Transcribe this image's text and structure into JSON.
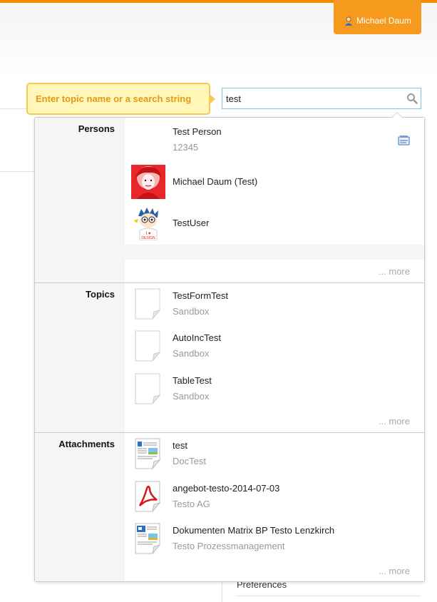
{
  "header": {
    "user_name": "Michael Daum",
    "accent_color": "#f28c00",
    "user_icon": "user-icon"
  },
  "background": {
    "stray_text": "{",
    "preferences_link": "Preferences"
  },
  "search": {
    "tooltip": "Enter topic name or a search string",
    "value": "test",
    "icon": "search-icon"
  },
  "results": {
    "more_label": "... more",
    "persons": {
      "label": "Persons",
      "items": [
        {
          "name": "Test Person",
          "detail": "12345",
          "icon": "vcard-icon"
        },
        {
          "name": "Michael Daum (Test)",
          "detail": ""
        },
        {
          "name": "TestUser",
          "detail": ""
        }
      ]
    },
    "topics": {
      "label": "Topics",
      "items": [
        {
          "name": "TestFormTest",
          "detail": "Sandbox",
          "icon": "document-icon"
        },
        {
          "name": "AutoIncTest",
          "detail": "Sandbox",
          "icon": "document-icon"
        },
        {
          "name": "TableTest",
          "detail": "Sandbox",
          "icon": "document-icon"
        }
      ]
    },
    "attachments": {
      "label": "Attachments",
      "items": [
        {
          "name": "test",
          "detail": "DocTest",
          "icon": "doc-file-icon"
        },
        {
          "name": "angebot-testo-2014-07-03",
          "detail": "Testo AG",
          "icon": "pdf-file-icon"
        },
        {
          "name": "Dokumenten Matrix BP Testo Lenzkirch",
          "detail": "Testo Prozessmanagement",
          "icon": "doc-file-icon"
        }
      ]
    }
  }
}
